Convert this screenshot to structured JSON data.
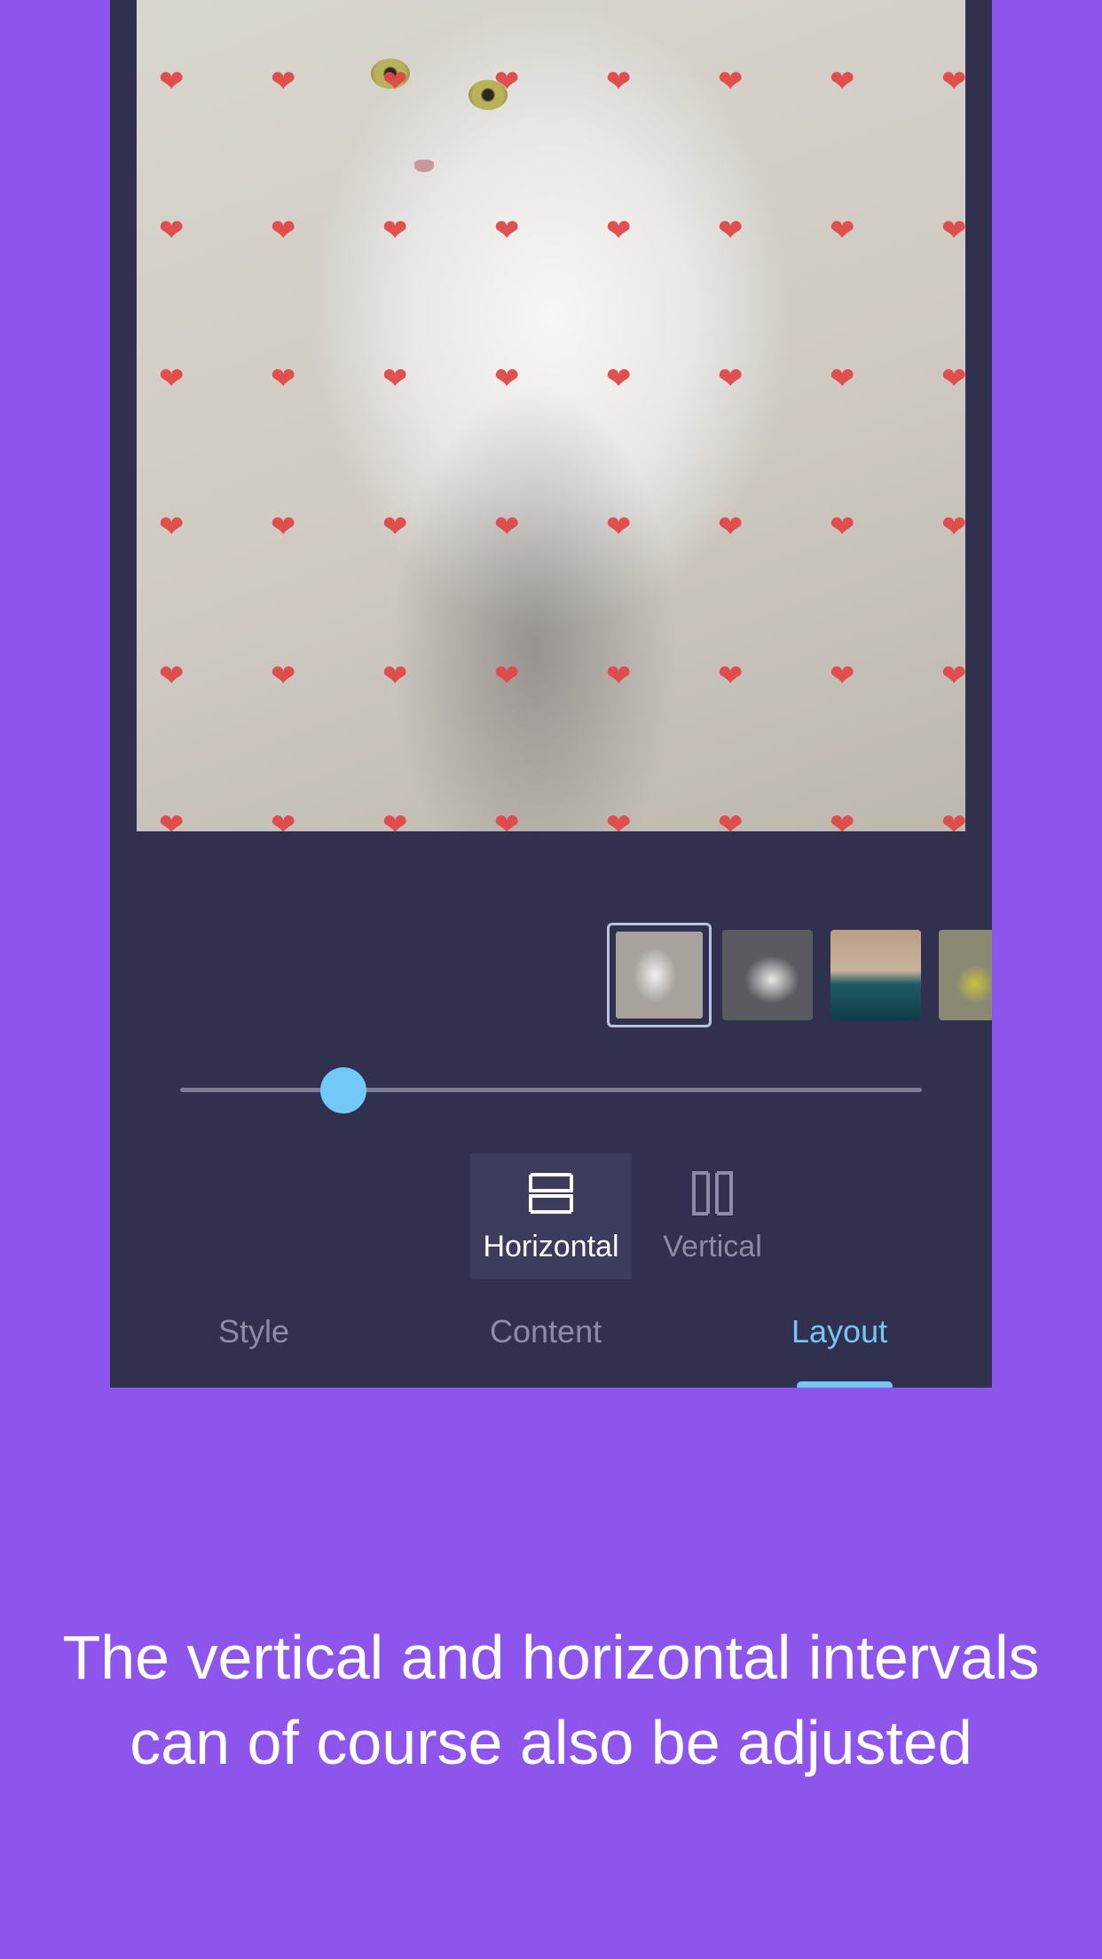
{
  "preview": {
    "heart_glyph": "❤",
    "heart_color": "#e14848"
  },
  "thumbnails": [
    {
      "name": "thumbnail-1",
      "selected": true
    },
    {
      "name": "thumbnail-2",
      "selected": false
    },
    {
      "name": "thumbnail-3",
      "selected": false
    },
    {
      "name": "thumbnail-4",
      "selected": false
    },
    {
      "name": "thumbnail-5",
      "selected": false
    }
  ],
  "slider": {
    "value_fraction": 0.22,
    "accent": "#72c8f6"
  },
  "orientation": {
    "horizontal_label": "Horizontal",
    "vertical_label": "Vertical",
    "selected": "Horizontal"
  },
  "tabs": {
    "style": "Style",
    "content": "Content",
    "layout": "Layout",
    "active": "Layout"
  },
  "caption": "The vertical and horizontal intervals can of course also be adjusted",
  "colors": {
    "background": "#8e55ec",
    "panel": "#31304f",
    "accent": "#74c6f6"
  }
}
